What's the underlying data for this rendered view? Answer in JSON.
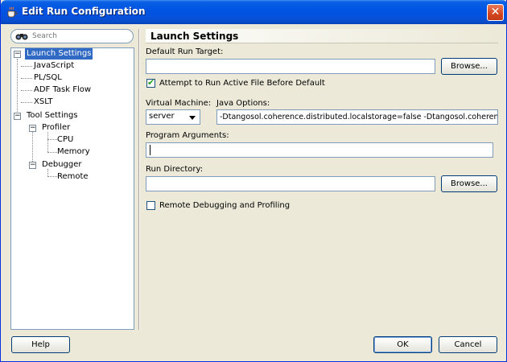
{
  "window": {
    "title": "Edit Run Configuration",
    "close_label": "✕"
  },
  "search": {
    "placeholder": "Search"
  },
  "tree": {
    "items": [
      {
        "label": "Launch Settings",
        "selected": true
      },
      {
        "label": "JavaScript"
      },
      {
        "label": "PL/SQL"
      },
      {
        "label": "ADF Task Flow"
      },
      {
        "label": "XSLT"
      },
      {
        "label": "Tool Settings"
      },
      {
        "label": "Profiler"
      },
      {
        "label": "CPU"
      },
      {
        "label": "Memory"
      },
      {
        "label": "Debugger"
      },
      {
        "label": "Remote"
      }
    ],
    "expander_symbol": "−"
  },
  "panel": {
    "title": "Launch Settings",
    "default_run_target_label": "Default Run Target:",
    "default_run_target_value": "",
    "browse_label": "Browse...",
    "attempt_run_label": "Attempt to Run Active File Before Default",
    "attempt_run_checked": true,
    "virtual_machine_label": "Virtual Machine:",
    "virtual_machine_value": "server",
    "java_options_label": "Java Options:",
    "java_options_value": "-Dtangosol.coherence.distributed.localstorage=false -Dtangosol.coherence.log",
    "program_arguments_label": "Program Arguments:",
    "program_arguments_value": "",
    "run_directory_label": "Run Directory:",
    "run_directory_value": "",
    "browse2_label": "Browse...",
    "remote_debug_label": "Remote Debugging and Profiling",
    "remote_debug_checked": false
  },
  "footer": {
    "help_label": "Help",
    "ok_label": "OK",
    "cancel_label": "Cancel"
  },
  "colors": {
    "titlebar": "#0054e3",
    "selection": "#316ac5",
    "dialog_bg": "#ece9d8"
  }
}
